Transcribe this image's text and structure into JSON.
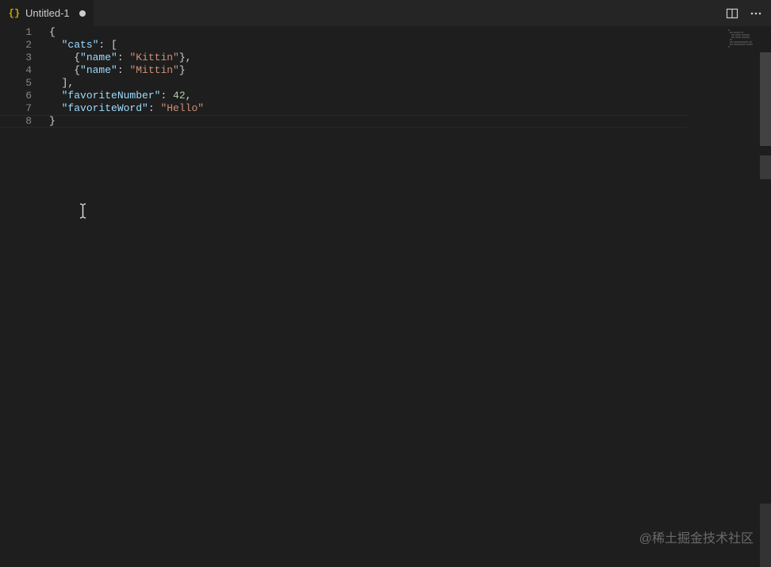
{
  "tab": {
    "icon_name": "json-icon",
    "icon_glyph": "{}",
    "label": "Untitled-1",
    "dirty": true
  },
  "actions": {
    "split": "split-editor",
    "more": "more-actions"
  },
  "line_numbers": [
    "1",
    "2",
    "3",
    "4",
    "5",
    "6",
    "7",
    "8"
  ],
  "code": {
    "lines": [
      {
        "tokens": [
          {
            "t": "{",
            "c": "d"
          }
        ]
      },
      {
        "indent": "  ",
        "tokens": [
          {
            "t": "\"cats\"",
            "c": "k"
          },
          {
            "t": ": [",
            "c": "p"
          }
        ]
      },
      {
        "indent": "    ",
        "tokens": [
          {
            "t": "{",
            "c": "d"
          },
          {
            "t": "\"name\"",
            "c": "k"
          },
          {
            "t": ": ",
            "c": "p"
          },
          {
            "t": "\"Kittin\"",
            "c": "s"
          },
          {
            "t": "},",
            "c": "p"
          }
        ]
      },
      {
        "indent": "    ",
        "tokens": [
          {
            "t": "{",
            "c": "d"
          },
          {
            "t": "\"name\"",
            "c": "k"
          },
          {
            "t": ": ",
            "c": "p"
          },
          {
            "t": "\"Mittin\"",
            "c": "s"
          },
          {
            "t": "}",
            "c": "p"
          }
        ]
      },
      {
        "indent": "  ",
        "tokens": [
          {
            "t": "],",
            "c": "p"
          }
        ]
      },
      {
        "indent": "  ",
        "tokens": [
          {
            "t": "\"favoriteNumber\"",
            "c": "k"
          },
          {
            "t": ": ",
            "c": "p"
          },
          {
            "t": "42",
            "c": "n"
          },
          {
            "t": ",",
            "c": "p"
          }
        ]
      },
      {
        "indent": "  ",
        "tokens": [
          {
            "t": "\"favoriteWord\"",
            "c": "k"
          },
          {
            "t": ": ",
            "c": "p"
          },
          {
            "t": "\"Hello\"",
            "c": "s"
          }
        ]
      },
      {
        "tokens": [
          {
            "t": "}",
            "c": "d"
          }
        ]
      }
    ]
  },
  "watermark": "@稀土掘金技术社区"
}
